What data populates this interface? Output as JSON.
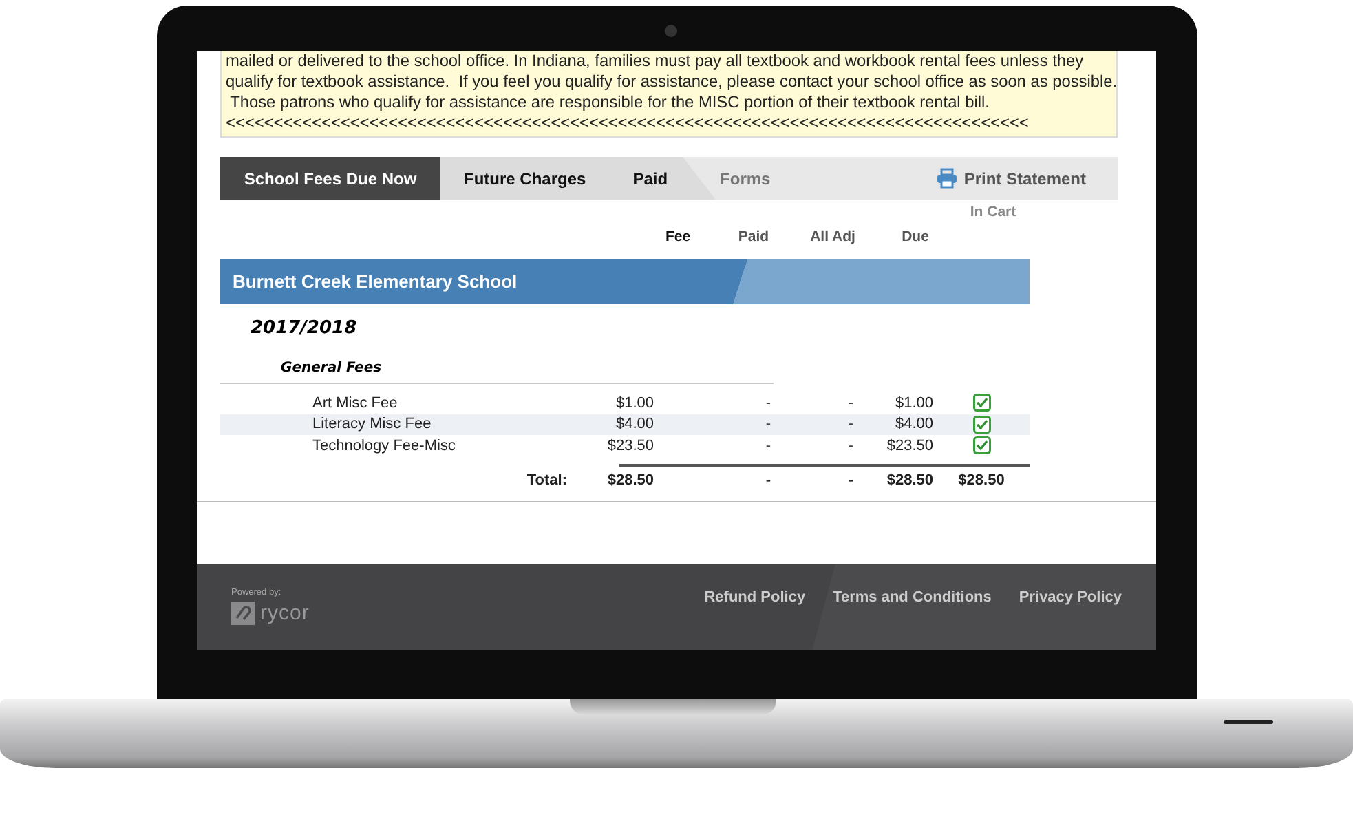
{
  "notice": {
    "lines": [
      "mailed or delivered to the school office. In Indiana, families must pay all textbook and workbook rental fees unless they",
      "qualify for textbook assistance.  If you feel you qualify for assistance, please contact your school office as soon as possible.",
      " Those patrons who qualify for assistance are responsible for the MISC portion of their textbook rental bill.",
      "<<<<<<<<<<<<<<<<<<<<<<<<<<<<<<<<<<<<<<<<<<<<<<<<<<<<<<<<<<<<<<<<<<<<<<<<<<<<<<<<<<<<"
    ]
  },
  "tabs": [
    {
      "label": "School Fees Due Now",
      "selected": true,
      "disabled": false
    },
    {
      "label": "Future Charges",
      "selected": false,
      "disabled": false
    },
    {
      "label": "Paid",
      "selected": false,
      "disabled": false
    },
    {
      "label": "Forms",
      "selected": false,
      "disabled": true
    }
  ],
  "print_button": "Print Statement",
  "in_cart_label": "In Cart",
  "columns": [
    "Fee",
    "Paid",
    "All Adj",
    "Due"
  ],
  "school": "Burnett Creek Elementary School",
  "year": "2017/2018",
  "group": "General Fees",
  "rows": [
    {
      "name": "Art Misc Fee",
      "fee": "$1.00",
      "paid": "-",
      "adj": "-",
      "due": "$1.00",
      "in_cart": true
    },
    {
      "name": "Literacy Misc Fee",
      "fee": "$4.00",
      "paid": "-",
      "adj": "-",
      "due": "$4.00",
      "in_cart": true
    },
    {
      "name": "Technology Fee-Misc",
      "fee": "$23.50",
      "paid": "-",
      "adj": "-",
      "due": "$23.50",
      "in_cart": true
    }
  ],
  "total": {
    "label": "Total:",
    "fee": "$28.50",
    "paid": "-",
    "adj": "-",
    "due": "$28.50",
    "cart": "$28.50"
  },
  "footer": {
    "powered_by": "Powered by:",
    "brand": "rycor",
    "links": [
      "Refund Policy",
      "Terms and Conditions",
      "Privacy Policy"
    ]
  }
}
